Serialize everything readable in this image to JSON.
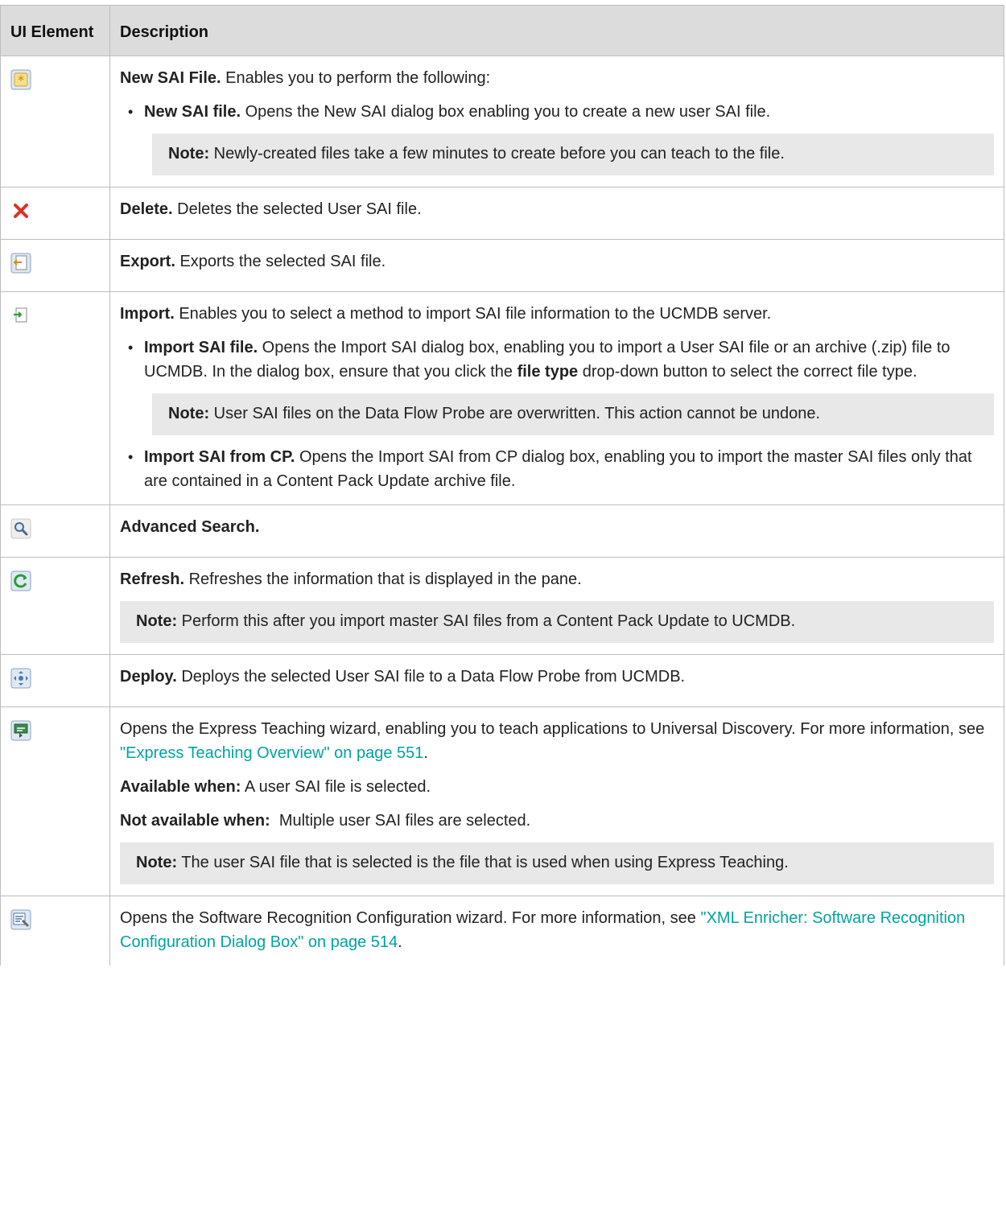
{
  "header": {
    "col1": "UI Element",
    "col2": "Description"
  },
  "rows": {
    "new": {
      "icon": "new-file-icon",
      "title": "New SAI File.",
      "text": " Enables you to perform the following:",
      "bullet_title": "New SAI file.",
      "bullet_text": " Opens the New SAI dialog box enabling you to create a new user SAI file.",
      "note_label": "Note:",
      "note_text": " Newly-created files take a few minutes to create before you can teach to the file."
    },
    "delete": {
      "icon": "delete-icon",
      "title": "Delete.",
      "text": " Deletes the selected User SAI file."
    },
    "export": {
      "icon": "export-icon",
      "title": "Export.",
      "text": " Exports the selected SAI file."
    },
    "import": {
      "icon": "import-icon",
      "title": "Import.",
      "text": " Enables you to select a method to import SAI file information to the UCMDB server.",
      "b1_title": "Import SAI file.",
      "b1_text_a": " Opens the Import SAI dialog box, enabling you to import a User SAI file or an archive (.zip) file to UCMDB. In the dialog box, ensure that you click the ",
      "b1_bold": "file type",
      "b1_text_b": " drop-down button to select the correct file type.",
      "note_label": "Note:",
      "note_text": " User SAI files on the Data Flow Probe are overwritten. This action cannot be undone.",
      "b2_title": "Import SAI from CP.",
      "b2_text": " Opens the Import SAI from CP dialog box, enabling you to import the master SAI files only that are contained in a Content Pack Update archive file."
    },
    "search": {
      "icon": "search-icon",
      "title": "Advanced Search."
    },
    "refresh": {
      "icon": "refresh-icon",
      "title": "Refresh.",
      "text": " Refreshes the information that is displayed in the pane.",
      "note_label": "Note:",
      "note_text": " Perform this after you import master SAI files from a Content Pack Update to UCMDB."
    },
    "deploy": {
      "icon": "deploy-icon",
      "title": "Deploy.",
      "text": " Deploys the selected User SAI file to a Data Flow Probe from UCMDB."
    },
    "express": {
      "icon": "express-teaching-icon",
      "text": "Opens the Express Teaching wizard, enabling you to teach applications to Universal Discovery. For more information, see ",
      "link": "\"Express Teaching Overview\" on page 551",
      "text_end": ".",
      "avail_label": "Available when:",
      "avail_text": " A user SAI file is selected.",
      "notavail_label": "Not available when:",
      "notavail_text": "  Multiple user SAI files are selected.",
      "note_label": "Note:",
      "note_text": " The user SAI file that is selected is the file that is used when using Express Teaching."
    },
    "recognition": {
      "icon": "software-recognition-icon",
      "text": "Opens the Software Recognition Configuration wizard. For more information, see ",
      "link": "\"XML Enricher: Software Recognition Configuration Dialog Box\" on page 514",
      "text_end": "."
    }
  },
  "colors": {
    "link": "#00a3a3",
    "header_bg": "#dcdcdc",
    "note_bg": "#e8e8e8"
  }
}
